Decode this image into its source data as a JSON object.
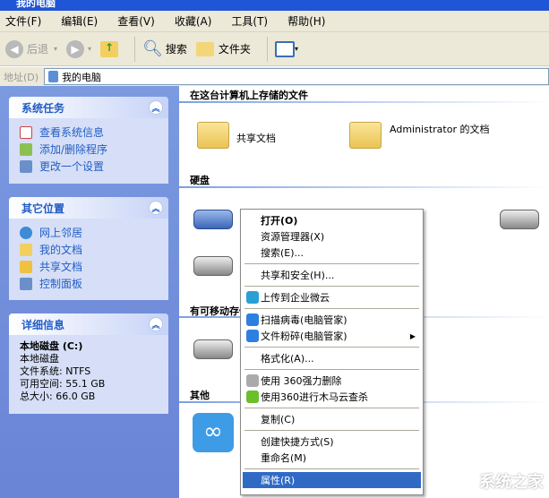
{
  "window": {
    "title": "我的电脑"
  },
  "menubar": [
    "文件(F)",
    "编辑(E)",
    "查看(V)",
    "收藏(A)",
    "工具(T)",
    "帮助(H)"
  ],
  "toolbar": {
    "back": "后退",
    "search": "搜索",
    "folders": "文件夹"
  },
  "address": {
    "label": "地址(D)",
    "value": "我的电脑"
  },
  "left": {
    "system_tasks": {
      "title": "系统任务",
      "items": [
        "查看系统信息",
        "添加/删除程序",
        "更改一个设置"
      ]
    },
    "other_places": {
      "title": "其它位置",
      "items": [
        "网上邻居",
        "我的文档",
        "共享文档",
        "控制面板"
      ]
    },
    "details": {
      "title": "详细信息",
      "name": "本地磁盘 (C:)",
      "type": "本地磁盘",
      "fs": "文件系统: NTFS",
      "free": "可用空间: 55.1 GB",
      "total": "总大小: 66.0 GB"
    }
  },
  "main": {
    "stored_files": {
      "title": "在这台计算机上存储的文件",
      "items": [
        "共享文档",
        "Administrator 的文档"
      ]
    },
    "hard_disks": {
      "title": "硬盘",
      "partial_label": ":)"
    },
    "removable": {
      "title": "有可移动存储的设备"
    },
    "other": {
      "title": "其他"
    }
  },
  "context_menu": [
    {
      "label": "打开(O)",
      "bold": true
    },
    {
      "label": "资源管理器(X)"
    },
    {
      "label": "搜索(E)..."
    },
    {
      "sep": true
    },
    {
      "label": "共享和安全(H)..."
    },
    {
      "sep": true
    },
    {
      "label": "上传到企业微云",
      "icon": "cloud-icon",
      "color": "#2a9fd6"
    },
    {
      "sep": true
    },
    {
      "label": "扫描病毒(电脑管家)",
      "icon": "shield-icon",
      "color": "#2f7fe0"
    },
    {
      "label": "文件粉碎(电脑管家)",
      "icon": "shield-icon",
      "color": "#2f7fe0",
      "submenu": true
    },
    {
      "sep": true
    },
    {
      "label": "格式化(A)..."
    },
    {
      "sep": true
    },
    {
      "label": "使用 360强力删除",
      "icon": "shredder-icon",
      "color": "#aaaaaa"
    },
    {
      "label": "使用360进行木马云查杀",
      "icon": "360-icon",
      "color": "#6bbf2a"
    },
    {
      "sep": true
    },
    {
      "label": "复制(C)"
    },
    {
      "sep": true
    },
    {
      "label": "创建快捷方式(S)"
    },
    {
      "label": "重命名(M)"
    },
    {
      "sep": true
    },
    {
      "label": "属性(R)",
      "highlight": true
    }
  ],
  "watermark": "系统之家"
}
